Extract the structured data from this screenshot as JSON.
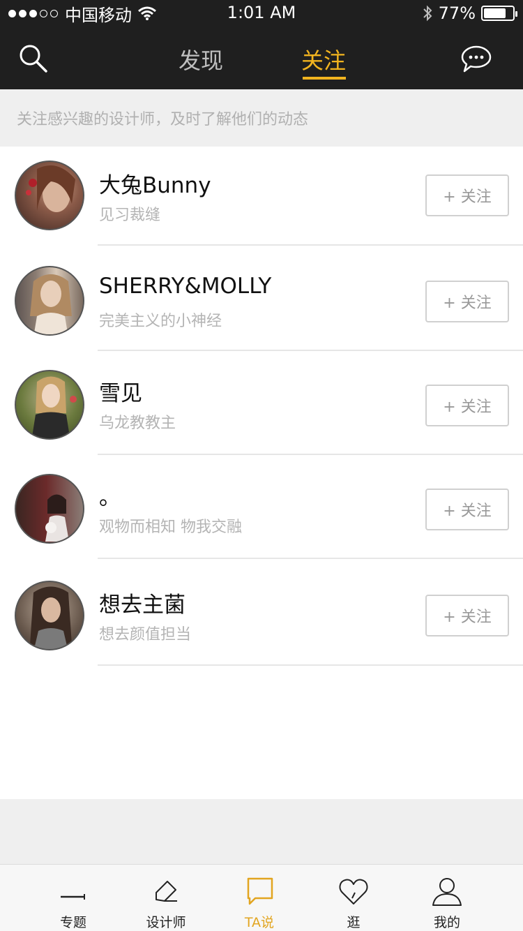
{
  "status_bar": {
    "carrier": "中国移动",
    "time": "1:01 AM",
    "battery": "77%",
    "battery_level": 0.77,
    "signal_bars": 3
  },
  "nav": {
    "tabs": [
      {
        "label": "发现"
      },
      {
        "label": "关注"
      }
    ],
    "active_tab": "关注",
    "accent": "#f2b41f"
  },
  "hint": "关注感兴趣的设计师，及时了解他们的动态",
  "users": [
    {
      "name": "大兔Bunny",
      "bio": "见习裁缝",
      "follow_label": "+ 关注"
    },
    {
      "name": "SHERRY&MOLLY",
      "bio": "完美主义的小神经",
      "follow_label": "+ 关注"
    },
    {
      "name": "雪见",
      "bio": "乌龙教教主",
      "follow_label": "+ 关注"
    },
    {
      "name": "。",
      "bio": "观物而相知   物我交融",
      "follow_label": "+ 关注"
    },
    {
      "name": "想去主菌",
      "bio": "想去颜值担当",
      "follow_label": "+ 关注"
    }
  ],
  "tabbar": {
    "items": [
      {
        "label": "专题",
        "icon": "topic-icon"
      },
      {
        "label": "设计师",
        "icon": "pencil-icon"
      },
      {
        "label": "TA说",
        "icon": "speech-bubble-icon"
      },
      {
        "label": "逛",
        "icon": "heart-icon"
      },
      {
        "label": "我的",
        "icon": "person-icon"
      }
    ],
    "active": "TA说",
    "active_color": "#e2a520"
  }
}
